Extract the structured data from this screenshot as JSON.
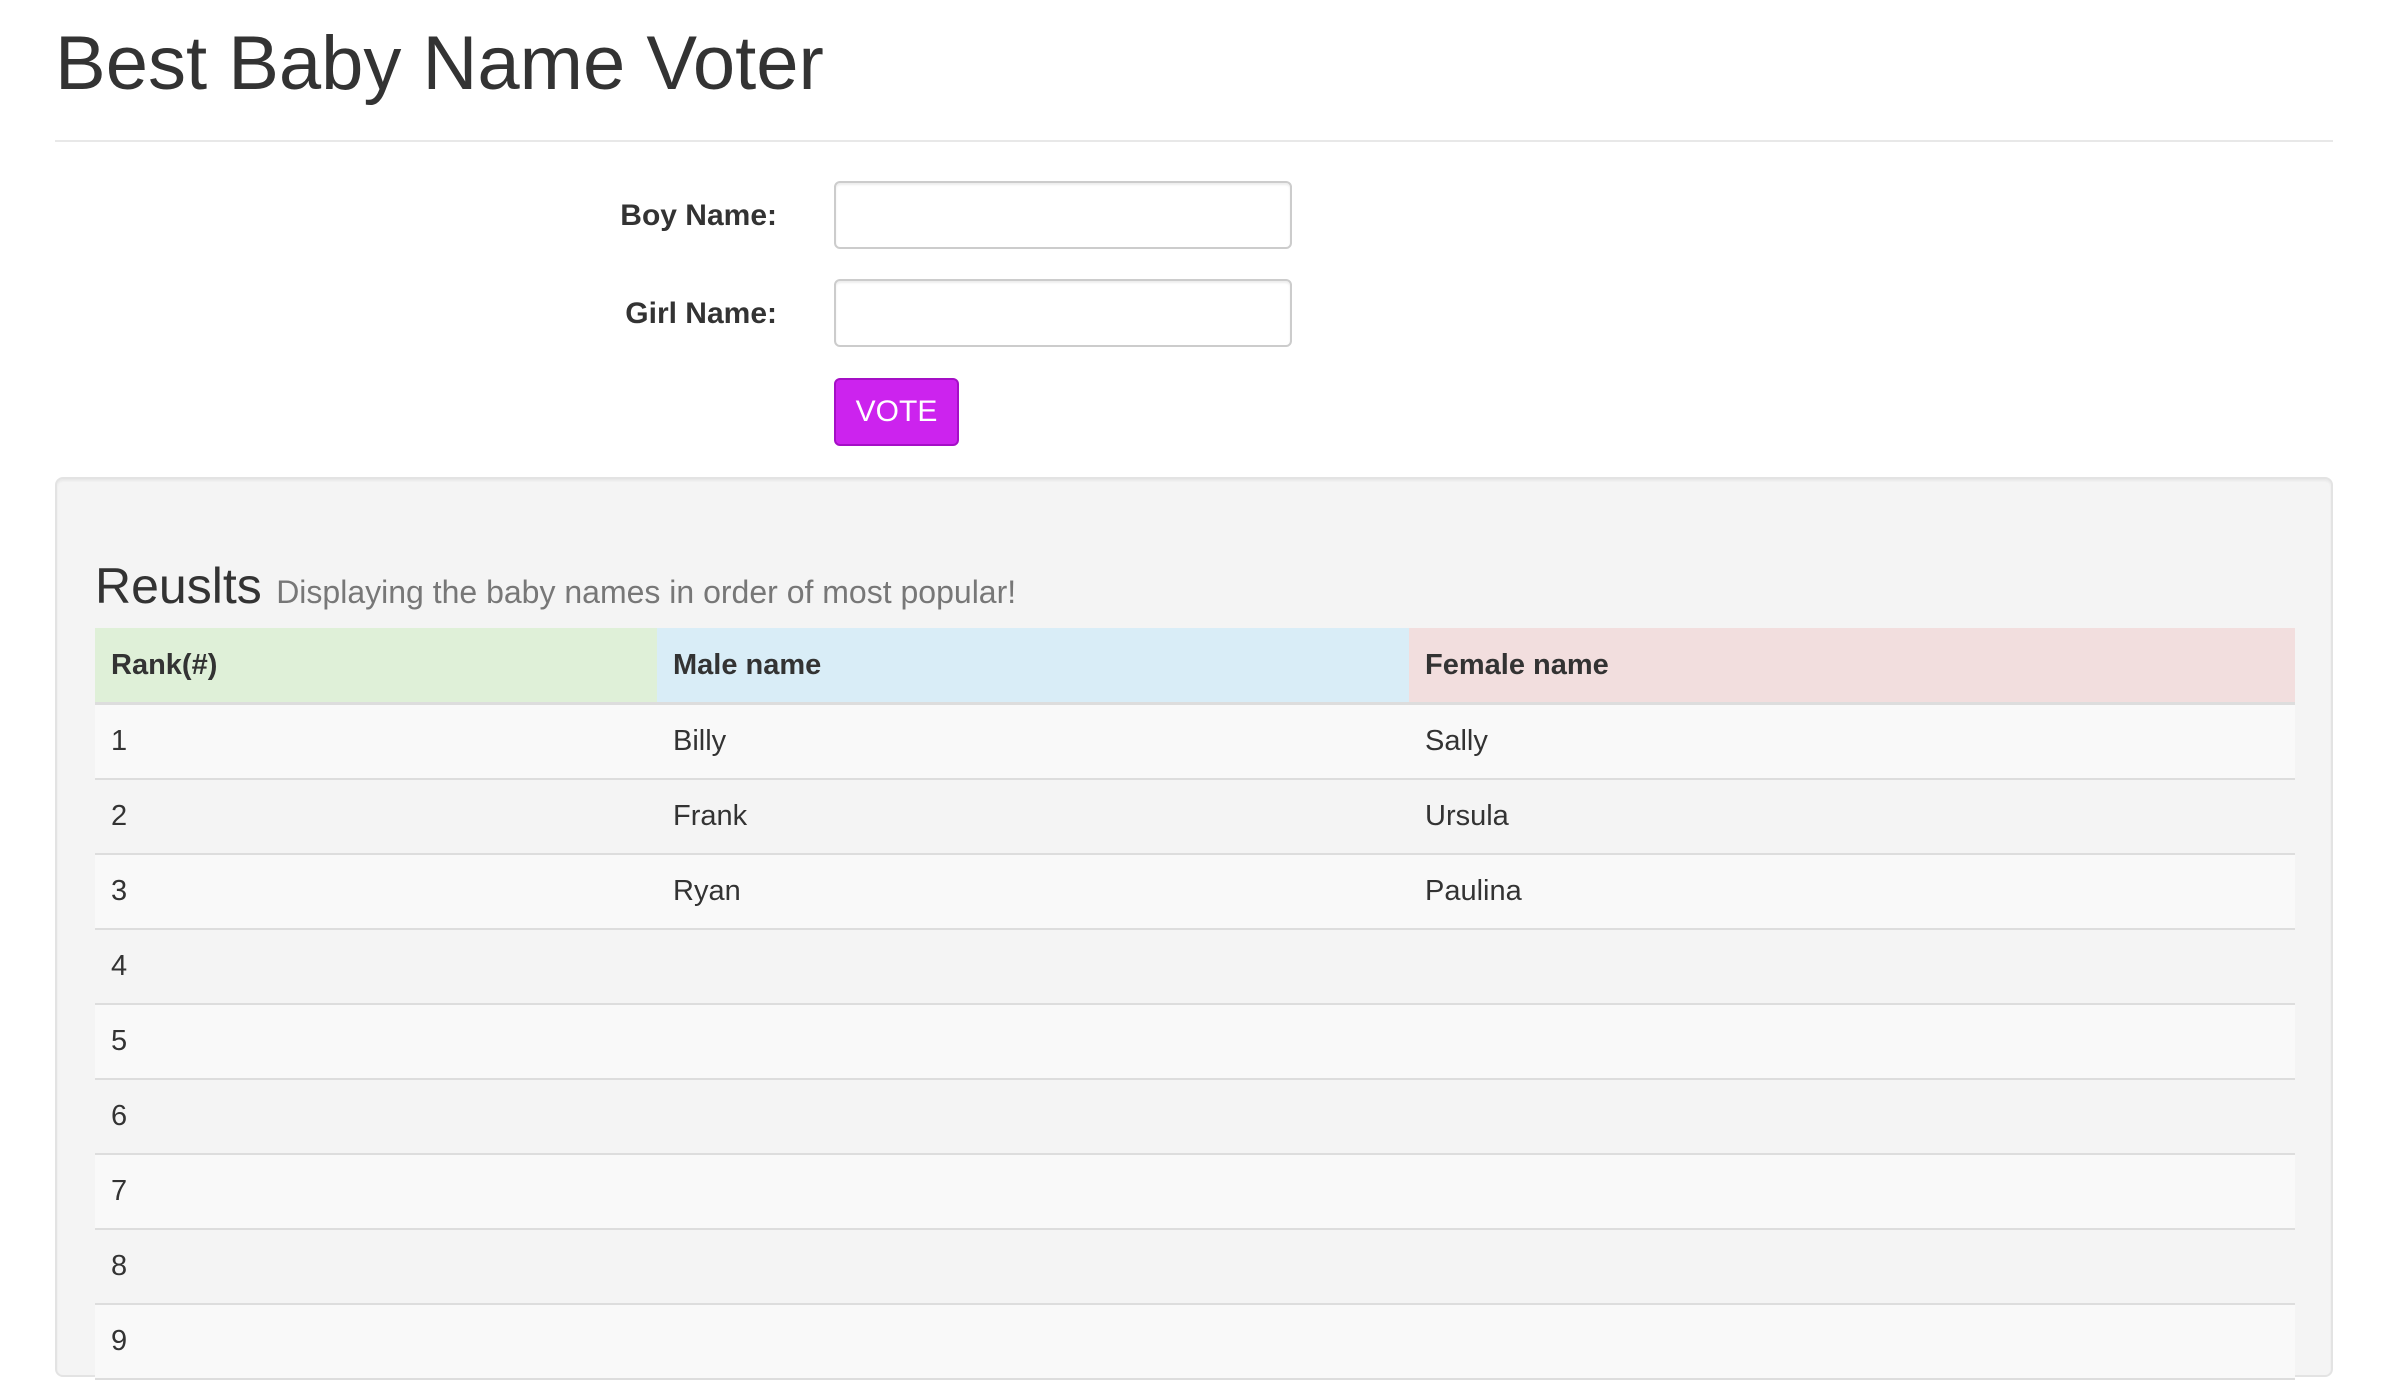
{
  "page": {
    "title": "Best Baby Name Voter"
  },
  "form": {
    "boy_label": "Boy Name:",
    "boy_value": "",
    "boy_placeholder": "",
    "girl_label": "Girl Name:",
    "girl_value": "",
    "girl_placeholder": "",
    "vote_label": "VOTE"
  },
  "results": {
    "title": "Reuslts",
    "subtitle": "Displaying the baby names in order of most popular!",
    "columns": [
      "Rank(#)",
      "Male name",
      "Female name"
    ],
    "rows": [
      [
        "1",
        "Billy",
        "Sally"
      ],
      [
        "2",
        "Frank",
        "Ursula"
      ],
      [
        "3",
        "Ryan",
        "Paulina"
      ],
      [
        "4",
        "",
        ""
      ],
      [
        "5",
        "",
        ""
      ],
      [
        "6",
        "",
        ""
      ],
      [
        "7",
        "",
        ""
      ],
      [
        "8",
        "",
        ""
      ],
      [
        "9",
        "",
        ""
      ]
    ]
  },
  "colors": {
    "vote_button": "#cc23ee",
    "rank_header": "#dff0d8",
    "male_header": "#d9edf7",
    "female_header": "#f2dede"
  }
}
